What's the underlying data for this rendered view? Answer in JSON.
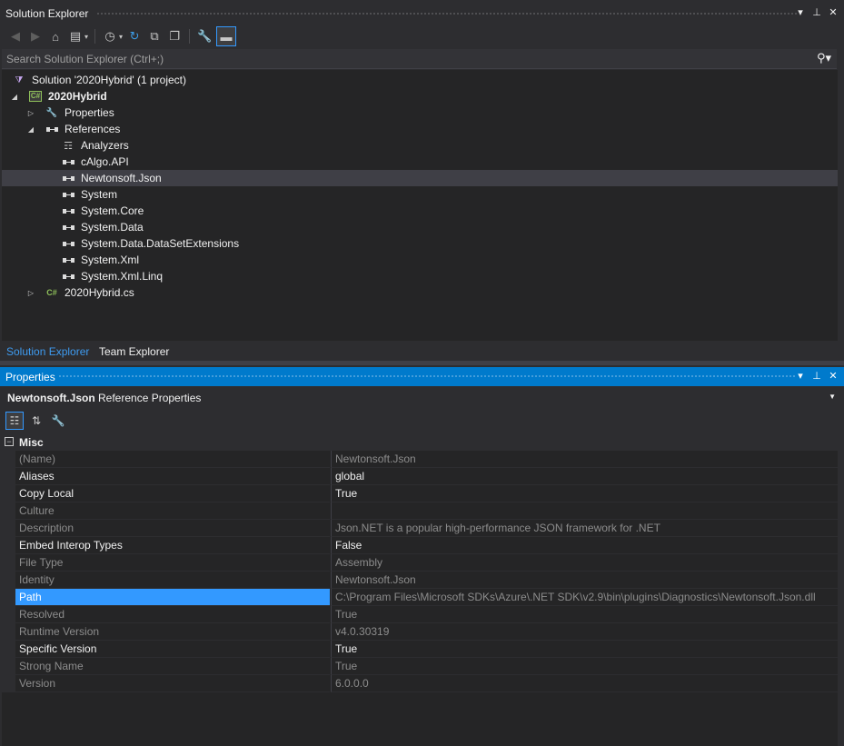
{
  "solution_explorer": {
    "title": "Solution Explorer",
    "search_placeholder": "Search Solution Explorer (Ctrl+;)",
    "tree": {
      "solution": "Solution '2020Hybrid' (1 project)",
      "project": "2020Hybrid",
      "properties": "Properties",
      "references": "References",
      "refs": [
        "Analyzers",
        "cAlgo.API",
        "Newtonsoft.Json",
        "System",
        "System.Core",
        "System.Data",
        "System.Data.DataSetExtensions",
        "System.Xml",
        "System.Xml.Linq"
      ],
      "file": "2020Hybrid.cs",
      "project_badge": "C#",
      "file_badge": "C#"
    }
  },
  "tabs": [
    "Solution Explorer",
    "Team Explorer"
  ],
  "properties_panel": {
    "title": "Properties",
    "object_name": "Newtonsoft.Json",
    "object_type": "Reference Properties",
    "category": "Misc",
    "rows": [
      {
        "name": "(Name)",
        "value": "Newtonsoft.Json",
        "readonly": true
      },
      {
        "name": "Aliases",
        "value": "global",
        "readonly": false
      },
      {
        "name": "Copy Local",
        "value": "True",
        "readonly": false
      },
      {
        "name": "Culture",
        "value": "",
        "readonly": true
      },
      {
        "name": "Description",
        "value": "Json.NET is a popular high-performance JSON framework for .NET",
        "readonly": true
      },
      {
        "name": "Embed Interop Types",
        "value": "False",
        "readonly": false
      },
      {
        "name": "File Type",
        "value": "Assembly",
        "readonly": true
      },
      {
        "name": "Identity",
        "value": "Newtonsoft.Json",
        "readonly": true
      },
      {
        "name": "Path",
        "value": "C:\\Program Files\\Microsoft SDKs\\Azure\\.NET SDK\\v2.9\\bin\\plugins\\Diagnostics\\Newtonsoft.Json.dll",
        "readonly": true
      },
      {
        "name": "Resolved",
        "value": "True",
        "readonly": true
      },
      {
        "name": "Runtime Version",
        "value": "v4.0.30319",
        "readonly": true
      },
      {
        "name": "Specific Version",
        "value": "True",
        "readonly": false
      },
      {
        "name": "Strong Name",
        "value": "True",
        "readonly": true
      },
      {
        "name": "Version",
        "value": "6.0.0.0",
        "readonly": true
      }
    ]
  },
  "colors": {
    "accent": "#007acc",
    "selection": "#3399ff",
    "tab_active": "#3e9bf0"
  }
}
